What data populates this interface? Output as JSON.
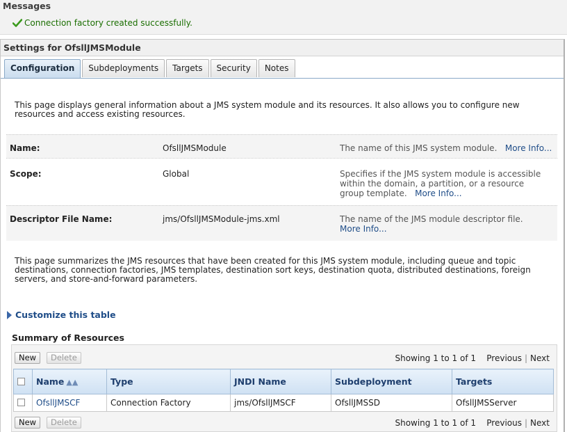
{
  "messages": {
    "title": "Messages",
    "success_text": "Connection factory created successfully."
  },
  "settings": {
    "title": "Settings for OfsllJMSModule",
    "tabs": [
      {
        "label": "Configuration",
        "active": true
      },
      {
        "label": "Subdeployments"
      },
      {
        "label": "Targets"
      },
      {
        "label": "Security"
      },
      {
        "label": "Notes"
      }
    ],
    "intro": "This page displays general information about a JMS system module and its resources. It also allows you to configure new resources and access existing resources.",
    "properties": [
      {
        "label": "Name:",
        "value": "OfsllJMSModule",
        "desc": "The name of this JMS system module.",
        "more": "More Info..."
      },
      {
        "label": "Scope:",
        "value": "Global",
        "desc": "Specifies if the JMS system module is accessible within the domain, a partition, or a resource group template.",
        "more": "More Info..."
      },
      {
        "label": "Descriptor File Name:",
        "value": "jms/OfsllJMSModule-jms.xml",
        "desc": "The name of the JMS module descriptor file.",
        "more": "More Info..."
      }
    ],
    "summary_intro": "This page summarizes the JMS resources that have been created for this JMS system module, including queue and topic destinations, connection factories, JMS templates, destination sort keys, destination quota, distributed destinations, foreign servers, and store-and-forward parameters.",
    "customize_label": "Customize this table",
    "summary_title": "Summary of Resources",
    "new_label": "New",
    "delete_label": "Delete",
    "showing_text": "Showing 1 to 1 of 1",
    "previous_label": "Previous",
    "next_label": "Next",
    "columns": [
      "Name",
      "Type",
      "JNDI Name",
      "Subdeployment",
      "Targets"
    ],
    "rows": [
      {
        "name": "OfsllJMSCF",
        "type": "Connection Factory",
        "jndi": "jms/OfsllJMSCF",
        "subdeployment": "OfsllJMSSD",
        "targets": "OfsllJMSServer"
      }
    ]
  },
  "colors": {
    "success": "#1a6e00",
    "link": "#1f4d88",
    "header_bg": "#cfe1f3"
  },
  "icons": [
    "checkmark-icon",
    "sort-ascending-icon",
    "expand-triangle-icon"
  ]
}
